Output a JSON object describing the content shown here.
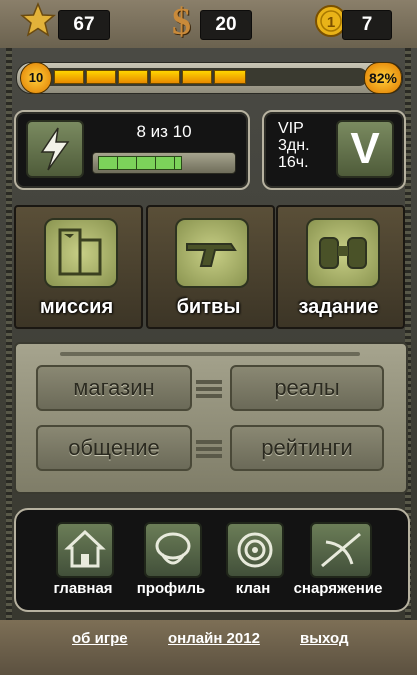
{
  "stats": {
    "stars": "67",
    "money": "20",
    "coins": "7"
  },
  "level": {
    "number": "10",
    "percent": "82%",
    "progress_fraction": 0.82
  },
  "energy": {
    "text": "8 из 10",
    "value": 8,
    "max": 10
  },
  "vip": {
    "line1": "VIP",
    "line2": "3дн.",
    "line3": "16ч.",
    "badge": "V"
  },
  "tiles": [
    {
      "label": "миссия",
      "icon": "mission-map-icon"
    },
    {
      "label": "битвы",
      "icon": "pistol-icon"
    },
    {
      "label": "задание",
      "icon": "binoculars-icon"
    }
  ],
  "menu": {
    "shop": "магазин",
    "reals": "реалы",
    "chat": "общение",
    "ratings": "рейтинги"
  },
  "nav": [
    {
      "label": "главная",
      "icon": "house-icon"
    },
    {
      "label": "профиль",
      "icon": "soldier-profile-icon"
    },
    {
      "label": "клан",
      "icon": "clan-emblem-icon"
    },
    {
      "label": "снаряжение",
      "icon": "crossbow-icon"
    }
  ],
  "footer": {
    "about": "об игре",
    "online": "онлайн 2012",
    "exit": "выход"
  },
  "colors": {
    "accent": "#ffd400",
    "progress_green": "#7cd35a"
  }
}
